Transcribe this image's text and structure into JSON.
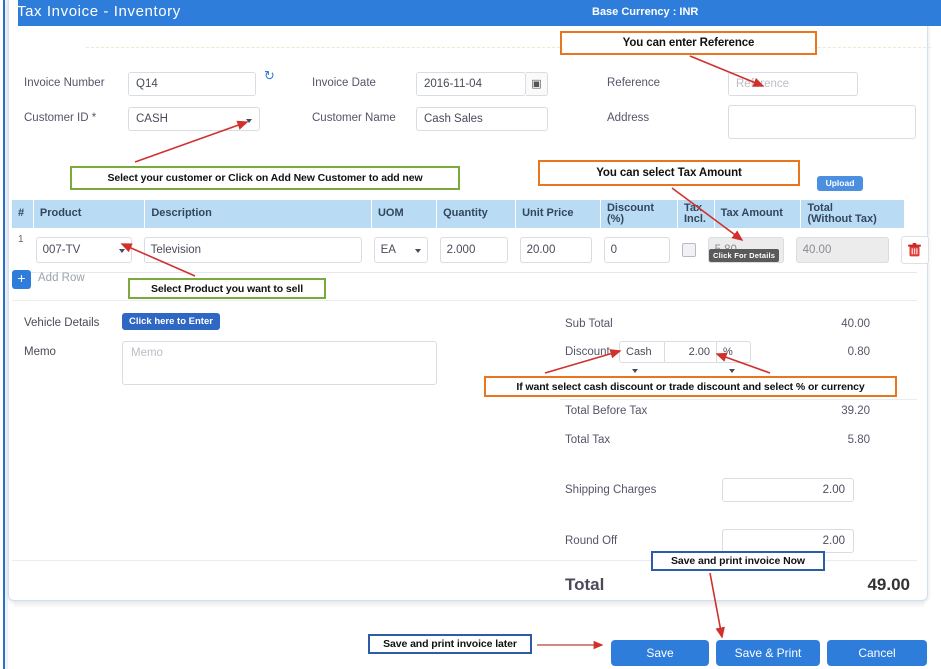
{
  "window": {
    "title": "Tax Invoice - Inventory",
    "base_currency": "Base Currency : INR"
  },
  "form": {
    "invoice_number_label": "Invoice Number",
    "invoice_number_value": "Q14",
    "refresh_icon": "refresh-icon",
    "invoice_date_label": "Invoice Date",
    "invoice_date_value": "2016-11-04",
    "calendar_icon": "calendar-icon",
    "reference_label": "Reference",
    "reference_placeholder": "Reference",
    "customer_id_label": "Customer ID *",
    "customer_id_value": "CASH",
    "customer_name_label": "Customer Name",
    "customer_name_value": "Cash Sales",
    "address_label": "Address",
    "address_value": ""
  },
  "upload": {
    "label": "Upload"
  },
  "table": {
    "headers": [
      "#",
      "Product",
      "Description",
      "UOM",
      "Quantity",
      "Unit Price",
      "Discount (%)",
      "Tax Incl.",
      "Tax Amount",
      "Total (Without Tax)"
    ],
    "headers_wrapped": {
      "discount_l1": "Discount",
      "discount_l2": "(%)",
      "tax_incl_l1": "Tax",
      "tax_incl_l2": "Incl.",
      "total_l1": "Total",
      "total_l2": "(Without Tax)"
    },
    "rows": [
      {
        "index": "1",
        "product": "007-TV",
        "description": "Television",
        "uom": "EA",
        "quantity": "2.000",
        "unit_price": "20.00",
        "discount": "0",
        "tax_incl_checked": false,
        "tax_amount": "5.80",
        "total_without_tax": "40.00",
        "delete_icon": "trash-icon"
      }
    ],
    "tax_tooltip": "Click For Details",
    "add_row_label": "Add Row",
    "add_row_icon": "plus-icon"
  },
  "details": {
    "vehicle_details_label": "Vehicle Details",
    "vehicle_details_button": "Click here to Enter",
    "memo_label": "Memo",
    "memo_placeholder": "Memo"
  },
  "totals": {
    "sub_total_label": "Sub Total",
    "sub_total_value": "40.00",
    "discount_label": "Discount",
    "discount_type": "Cash",
    "discount_amount": "2.00",
    "discount_unit": "%",
    "discount_value": "0.80",
    "total_before_tax_label": "Total Before Tax",
    "total_before_tax_value": "39.20",
    "total_tax_label": "Total Tax",
    "total_tax_value": "5.80",
    "shipping_label": "Shipping Charges",
    "shipping_value": "2.00",
    "round_off_label": "Round Off",
    "round_off_value": "2.00",
    "grand_total_label": "Total",
    "grand_total_value": "49.00"
  },
  "footer": {
    "save": "Save",
    "save_print": "Save & Print",
    "cancel": "Cancel"
  },
  "annotations": {
    "reference": "You can enter Reference",
    "customer": "Select your customer  or Click on Add  New Customer to add new",
    "tax_amount": "You can select Tax Amount",
    "product": "Select Product you want to sell",
    "discount": "If want select cash discount or trade discount and select % or currency",
    "save_now": "Save and print invoice Now",
    "save_later": "Save and print invoice later"
  },
  "colors": {
    "header_blue": "#2e7ddb",
    "table_header_blue": "#b9dcf4",
    "accent_orange": "#e8761e",
    "accent_green": "#7aa93c",
    "accent_navy": "#2c5ba8",
    "arrow_red": "#d0312d"
  }
}
